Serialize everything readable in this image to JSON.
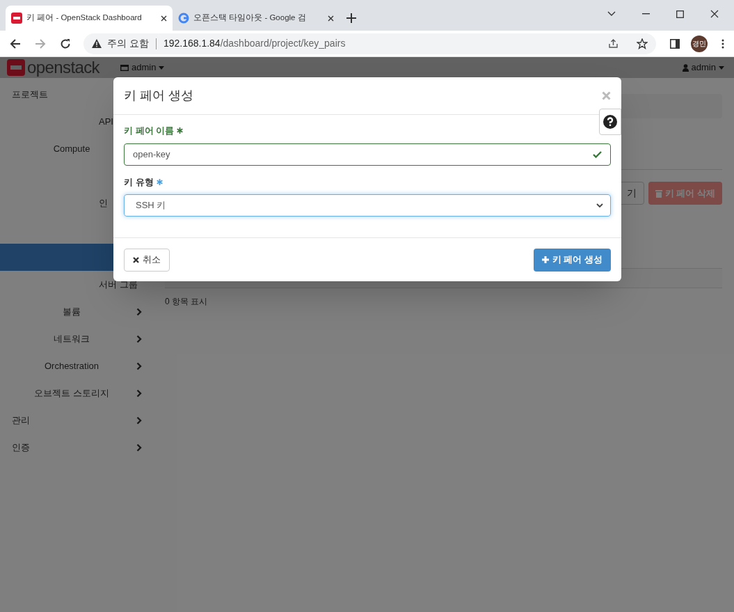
{
  "browser": {
    "tabs": [
      {
        "title": "키 페어 - OpenStack Dashboard",
        "selected": true
      },
      {
        "title": "오픈스택 타임아웃 - Google 검",
        "selected": false
      }
    ],
    "address": {
      "warning": "주의 요함",
      "host": "192.168.1.84",
      "path": "/dashboard/project/key_pairs"
    },
    "profile": "경민"
  },
  "header": {
    "brand": "openstack",
    "project": "admin",
    "user": "admin"
  },
  "sidebar": [
    {
      "kind": "section",
      "label": "프로젝트"
    },
    {
      "kind": "item",
      "label": "API"
    },
    {
      "kind": "group",
      "label": "Compute",
      "chevron": false
    },
    {
      "kind": "hidden"
    },
    {
      "kind": "item",
      "label": "인"
    },
    {
      "kind": "hidden"
    },
    {
      "kind": "hidden",
      "selected": true
    },
    {
      "kind": "item",
      "label": "서버 그룹"
    },
    {
      "kind": "group",
      "label": "볼륨",
      "chevron": true
    },
    {
      "kind": "group",
      "label": "네트워크",
      "chevron": true
    },
    {
      "kind": "group",
      "label": "Orchestration",
      "chevron": true
    },
    {
      "kind": "group",
      "label": "오브젝트 스토리지",
      "chevron": true
    },
    {
      "kind": "section",
      "label": "관리",
      "chevron": true
    },
    {
      "kind": "section",
      "label": "인증",
      "chevron": true
    }
  ],
  "content": {
    "buttons": [
      {
        "kind": "default",
        "label": "기"
      },
      {
        "kind": "danger",
        "label": "키 페어 삭제"
      }
    ],
    "count": "0 항목 표시"
  },
  "modal": {
    "title": "키 페어 생성",
    "fields": [
      {
        "kind": "text",
        "label": "키 페어 이름",
        "value": "open-key",
        "valid": true,
        "focused": false
      },
      {
        "kind": "select",
        "label": "키 유형",
        "value": "SSH 키",
        "valid": false,
        "focused": true
      }
    ],
    "cancel": "취소",
    "submit": "키 페어 생성"
  }
}
